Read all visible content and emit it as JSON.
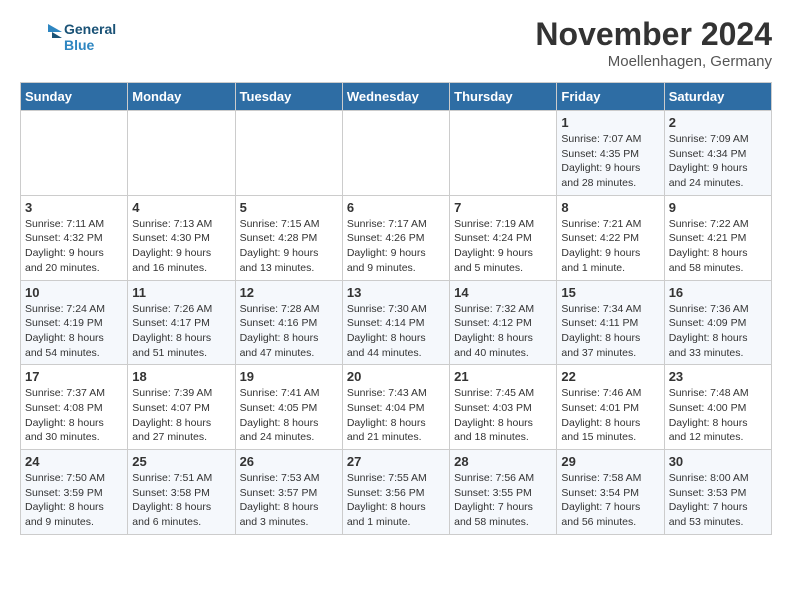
{
  "header": {
    "logo_line1": "General",
    "logo_line2": "Blue",
    "month": "November 2024",
    "location": "Moellenhagen, Germany"
  },
  "days_of_week": [
    "Sunday",
    "Monday",
    "Tuesday",
    "Wednesday",
    "Thursday",
    "Friday",
    "Saturday"
  ],
  "weeks": [
    [
      {
        "day": "",
        "info": ""
      },
      {
        "day": "",
        "info": ""
      },
      {
        "day": "",
        "info": ""
      },
      {
        "day": "",
        "info": ""
      },
      {
        "day": "",
        "info": ""
      },
      {
        "day": "1",
        "info": "Sunrise: 7:07 AM\nSunset: 4:35 PM\nDaylight: 9 hours and 28 minutes."
      },
      {
        "day": "2",
        "info": "Sunrise: 7:09 AM\nSunset: 4:34 PM\nDaylight: 9 hours and 24 minutes."
      }
    ],
    [
      {
        "day": "3",
        "info": "Sunrise: 7:11 AM\nSunset: 4:32 PM\nDaylight: 9 hours and 20 minutes."
      },
      {
        "day": "4",
        "info": "Sunrise: 7:13 AM\nSunset: 4:30 PM\nDaylight: 9 hours and 16 minutes."
      },
      {
        "day": "5",
        "info": "Sunrise: 7:15 AM\nSunset: 4:28 PM\nDaylight: 9 hours and 13 minutes."
      },
      {
        "day": "6",
        "info": "Sunrise: 7:17 AM\nSunset: 4:26 PM\nDaylight: 9 hours and 9 minutes."
      },
      {
        "day": "7",
        "info": "Sunrise: 7:19 AM\nSunset: 4:24 PM\nDaylight: 9 hours and 5 minutes."
      },
      {
        "day": "8",
        "info": "Sunrise: 7:21 AM\nSunset: 4:22 PM\nDaylight: 9 hours and 1 minute."
      },
      {
        "day": "9",
        "info": "Sunrise: 7:22 AM\nSunset: 4:21 PM\nDaylight: 8 hours and 58 minutes."
      }
    ],
    [
      {
        "day": "10",
        "info": "Sunrise: 7:24 AM\nSunset: 4:19 PM\nDaylight: 8 hours and 54 minutes."
      },
      {
        "day": "11",
        "info": "Sunrise: 7:26 AM\nSunset: 4:17 PM\nDaylight: 8 hours and 51 minutes."
      },
      {
        "day": "12",
        "info": "Sunrise: 7:28 AM\nSunset: 4:16 PM\nDaylight: 8 hours and 47 minutes."
      },
      {
        "day": "13",
        "info": "Sunrise: 7:30 AM\nSunset: 4:14 PM\nDaylight: 8 hours and 44 minutes."
      },
      {
        "day": "14",
        "info": "Sunrise: 7:32 AM\nSunset: 4:12 PM\nDaylight: 8 hours and 40 minutes."
      },
      {
        "day": "15",
        "info": "Sunrise: 7:34 AM\nSunset: 4:11 PM\nDaylight: 8 hours and 37 minutes."
      },
      {
        "day": "16",
        "info": "Sunrise: 7:36 AM\nSunset: 4:09 PM\nDaylight: 8 hours and 33 minutes."
      }
    ],
    [
      {
        "day": "17",
        "info": "Sunrise: 7:37 AM\nSunset: 4:08 PM\nDaylight: 8 hours and 30 minutes."
      },
      {
        "day": "18",
        "info": "Sunrise: 7:39 AM\nSunset: 4:07 PM\nDaylight: 8 hours and 27 minutes."
      },
      {
        "day": "19",
        "info": "Sunrise: 7:41 AM\nSunset: 4:05 PM\nDaylight: 8 hours and 24 minutes."
      },
      {
        "day": "20",
        "info": "Sunrise: 7:43 AM\nSunset: 4:04 PM\nDaylight: 8 hours and 21 minutes."
      },
      {
        "day": "21",
        "info": "Sunrise: 7:45 AM\nSunset: 4:03 PM\nDaylight: 8 hours and 18 minutes."
      },
      {
        "day": "22",
        "info": "Sunrise: 7:46 AM\nSunset: 4:01 PM\nDaylight: 8 hours and 15 minutes."
      },
      {
        "day": "23",
        "info": "Sunrise: 7:48 AM\nSunset: 4:00 PM\nDaylight: 8 hours and 12 minutes."
      }
    ],
    [
      {
        "day": "24",
        "info": "Sunrise: 7:50 AM\nSunset: 3:59 PM\nDaylight: 8 hours and 9 minutes."
      },
      {
        "day": "25",
        "info": "Sunrise: 7:51 AM\nSunset: 3:58 PM\nDaylight: 8 hours and 6 minutes."
      },
      {
        "day": "26",
        "info": "Sunrise: 7:53 AM\nSunset: 3:57 PM\nDaylight: 8 hours and 3 minutes."
      },
      {
        "day": "27",
        "info": "Sunrise: 7:55 AM\nSunset: 3:56 PM\nDaylight: 8 hours and 1 minute."
      },
      {
        "day": "28",
        "info": "Sunrise: 7:56 AM\nSunset: 3:55 PM\nDaylight: 7 hours and 58 minutes."
      },
      {
        "day": "29",
        "info": "Sunrise: 7:58 AM\nSunset: 3:54 PM\nDaylight: 7 hours and 56 minutes."
      },
      {
        "day": "30",
        "info": "Sunrise: 8:00 AM\nSunset: 3:53 PM\nDaylight: 7 hours and 53 minutes."
      }
    ]
  ]
}
